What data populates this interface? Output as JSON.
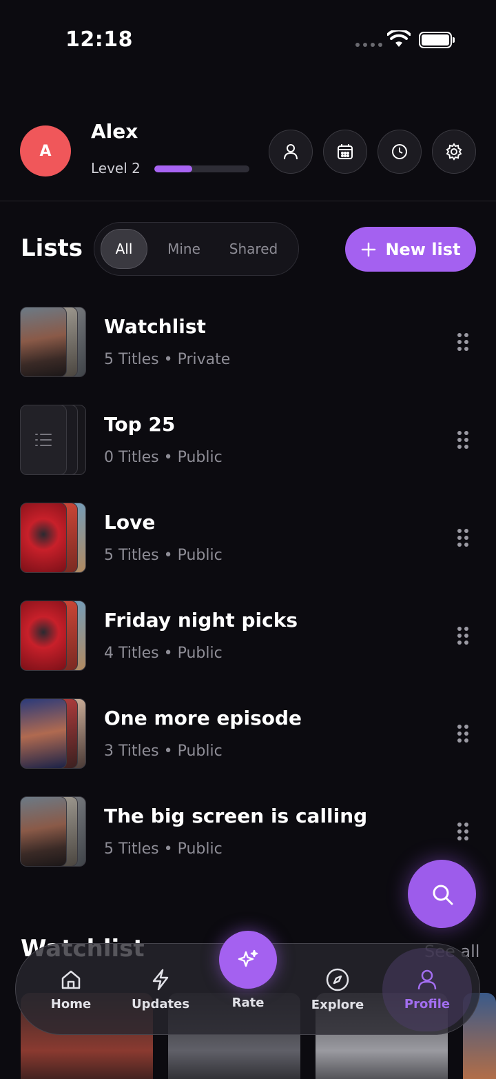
{
  "status_bar": {
    "time": "12:18"
  },
  "profile": {
    "initial": "A",
    "name": "Alex",
    "level": "Level 2",
    "level_progress": 0.4
  },
  "header_icons": [
    "person-icon",
    "calendar-icon",
    "clock-icon",
    "gear-icon"
  ],
  "lists": {
    "title": "Lists",
    "filters": [
      "All",
      "Mine",
      "Shared"
    ],
    "active_filter": "All",
    "new_list_label": "New list",
    "items": [
      {
        "title": "Watchlist",
        "subtitle": "5 Titles • Private",
        "thumb": "poster"
      },
      {
        "title": "Top 25",
        "subtitle": "0 Titles • Public",
        "thumb": "empty"
      },
      {
        "title": "Love",
        "subtitle": "5 Titles • Public",
        "thumb": "poster"
      },
      {
        "title": "Friday night picks",
        "subtitle": "4 Titles • Public",
        "thumb": "poster"
      },
      {
        "title": "One more episode",
        "subtitle": "3 Titles • Public",
        "thumb": "poster"
      },
      {
        "title": "The big screen is calling",
        "subtitle": "5 Titles • Public",
        "thumb": "poster"
      }
    ]
  },
  "watchlist_section": {
    "title": "Watchlist",
    "see_all": "See all"
  },
  "bottom_nav": {
    "items": [
      {
        "label": "Home",
        "icon": "home-icon"
      },
      {
        "label": "Updates",
        "icon": "bolt-icon"
      },
      {
        "label": "Rate",
        "icon": "sparkle-icon"
      },
      {
        "label": "Explore",
        "icon": "compass-icon"
      },
      {
        "label": "Profile",
        "icon": "person-icon"
      }
    ],
    "active": "Profile"
  },
  "colors": {
    "accent": "#a461f0",
    "avatar": "#f0575a",
    "background": "#0c0b10"
  }
}
